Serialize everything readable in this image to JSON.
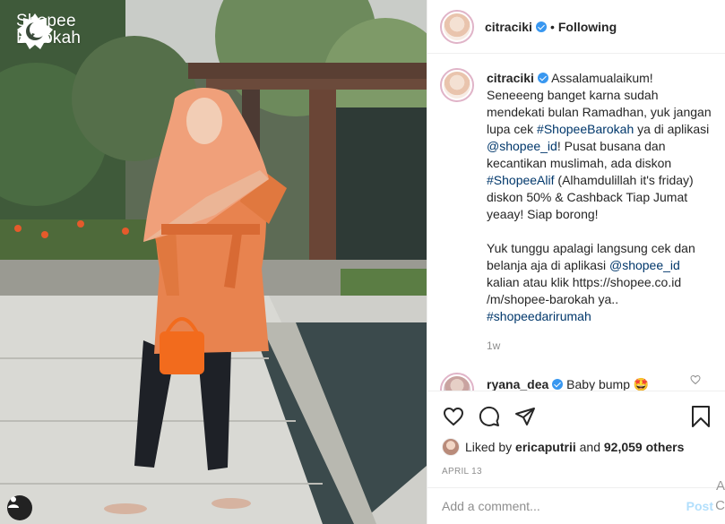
{
  "brand": {
    "line1": "Shopee",
    "line2": "Barokah"
  },
  "post": {
    "username": "citraciki",
    "follow_status": "Following",
    "dot": "•"
  },
  "caption": {
    "username": "citraciki",
    "p1a": "Assalamualaikum! Seneeeng banget karna sudah mendekati bulan Ramadhan, yuk jangan lupa cek ",
    "tag1": "#ShopeeBarokah",
    "p1b": " ya di aplikasi ",
    "mention1": "@shopee_id",
    "p1c": "! Pusat busana dan kecantikan muslimah, ada diskon ",
    "tag2": "#ShopeeAlif",
    "p1d": " (Alhamdulillah it's friday) diskon 50% & Cashback Tiap Jumat yeaay! Siap borong!",
    "p2a": "Yuk tunggu apalagi langsung cek dan belanja aja di aplikasi ",
    "mention2": "@shopee_id",
    "p2b": " kalian atau klik https://shopee.co.id /m/shopee-barokah ya..",
    "tag3": "#shopeedarirumah",
    "ago": "1w"
  },
  "comment": {
    "username": "ryana_dea",
    "text": "Baby bump 🤩"
  },
  "likes": {
    "prefix": "Liked by",
    "user": "ericaputrii",
    "and": "and",
    "count": "92,059 others"
  },
  "date": "APRIL 13",
  "add_comment": {
    "placeholder": "Add a comment...",
    "post_label": "Post"
  },
  "edge": {
    "a": "A",
    "c": "C"
  },
  "colors": {
    "link": "#00376b",
    "verified": "#3897f0",
    "post_disabled": "#b2dffc",
    "dress": "#e8834f"
  },
  "icons": [
    "shopee-barokah-logo-icon",
    "verified-icon",
    "heart-icon",
    "comment-icon",
    "share-icon",
    "bookmark-icon",
    "user-tag-icon"
  ]
}
